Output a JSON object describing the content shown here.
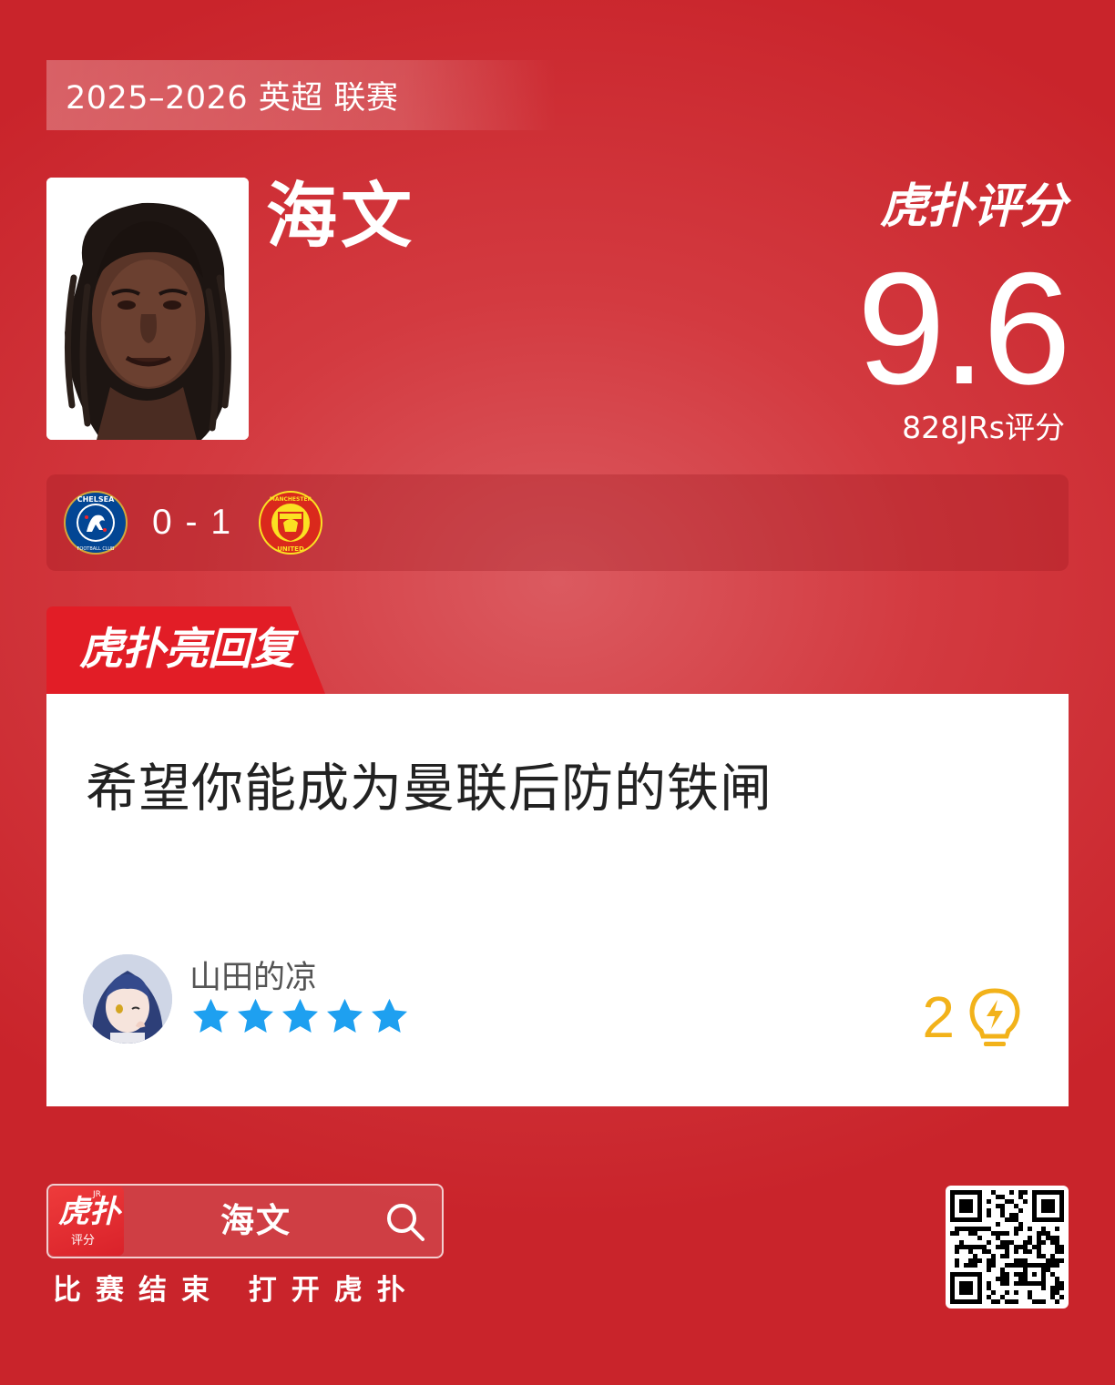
{
  "header": {
    "league_label": "2025–2026 英超 联赛"
  },
  "player": {
    "name": "海文",
    "photo_icon": "player-portrait"
  },
  "rating": {
    "brand": "虎扑评分",
    "brand_mark": "JR",
    "score": "9.6",
    "count_label": "828JRs评分"
  },
  "match": {
    "home_team_icon": "chelsea-badge",
    "score": "0 - 1",
    "away_team_icon": "manchester-united-badge",
    "home_badge_text_top": "CHELSEA",
    "home_badge_text_bottom": "FOOTBALL CLUB",
    "away_badge_text_top": "MANCHESTER",
    "away_badge_text_bottom": "UNITED"
  },
  "hot_reply": {
    "tab_label": "虎扑亮回复",
    "tab_mark": "JR",
    "text": "希望你能成为曼联后防的铁闸",
    "user": {
      "name": "山田的凉",
      "avatar_icon": "anime-avatar",
      "stars": 5
    },
    "likes": "2",
    "like_icon": "lightbulb-icon"
  },
  "footer": {
    "app_icon_main": "虎扑",
    "app_icon_sub": "评分",
    "app_icon_mark": "JR",
    "search_text": "海文",
    "promo_text": "比赛结束 打开虎扑",
    "qr_icon": "qr-code"
  },
  "colors": {
    "background": "#d33a40",
    "accent_red": "#e21d26",
    "star": "#1ea0f0",
    "like": "#f2b21a"
  }
}
